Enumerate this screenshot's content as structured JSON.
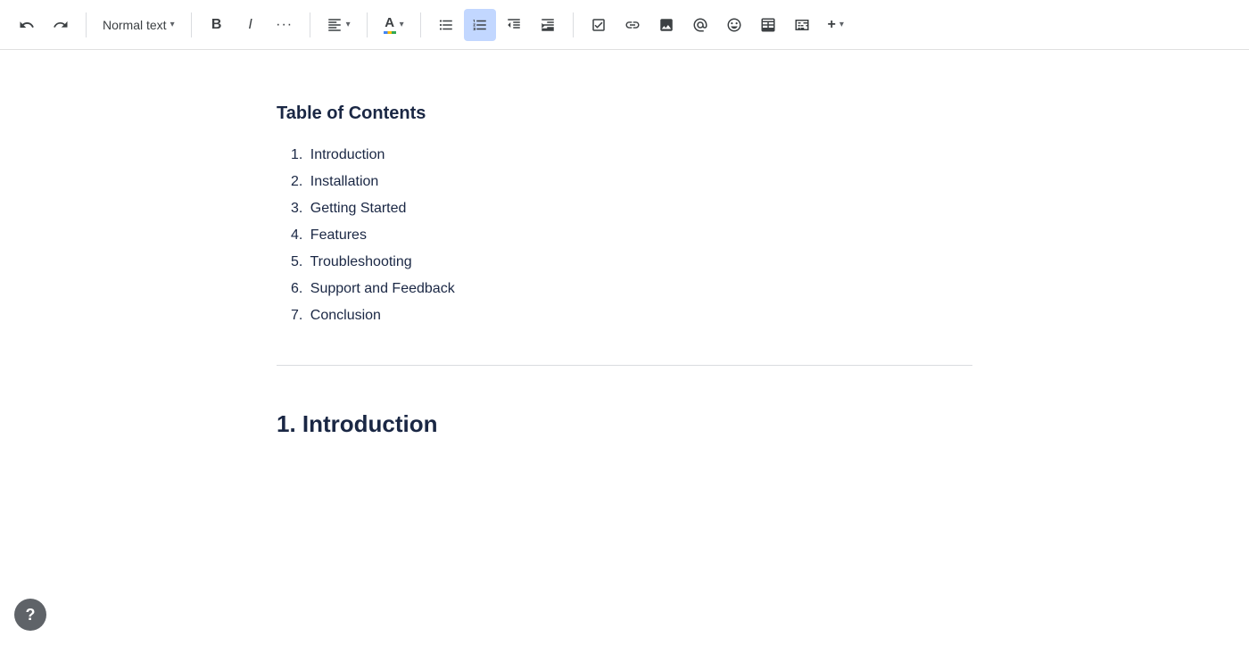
{
  "toolbar": {
    "undo_label": "↩",
    "redo_label": "↪",
    "text_style_label": "Normal text",
    "bold_label": "B",
    "italic_label": "I",
    "more_label": "···",
    "align_label": "≡",
    "text_color_label": "A",
    "bullet_list_label": "☰",
    "numbered_list_label": "☰",
    "indent_decrease_label": "⇤",
    "indent_increase_label": "⇥",
    "checkbox_label": "✓",
    "link_label": "🔗",
    "image_label": "🖼",
    "at_label": "@",
    "emoji_label": "☺",
    "table_label": "⊞",
    "columns_label": "⫿",
    "more2_label": "+"
  },
  "document": {
    "toc_title": "Table of Contents",
    "toc_items": [
      {
        "num": "1.",
        "text": "Introduction"
      },
      {
        "num": "2.",
        "text": "Installation"
      },
      {
        "num": "3.",
        "text": "Getting Started"
      },
      {
        "num": "4.",
        "text": "Features"
      },
      {
        "num": "5.",
        "text": "Troubleshooting"
      },
      {
        "num": "6.",
        "text": "Support and Feedback"
      },
      {
        "num": "7.",
        "text": "Conclusion"
      }
    ],
    "first_section_heading": "1. Introduction"
  },
  "help": {
    "label": "?"
  }
}
